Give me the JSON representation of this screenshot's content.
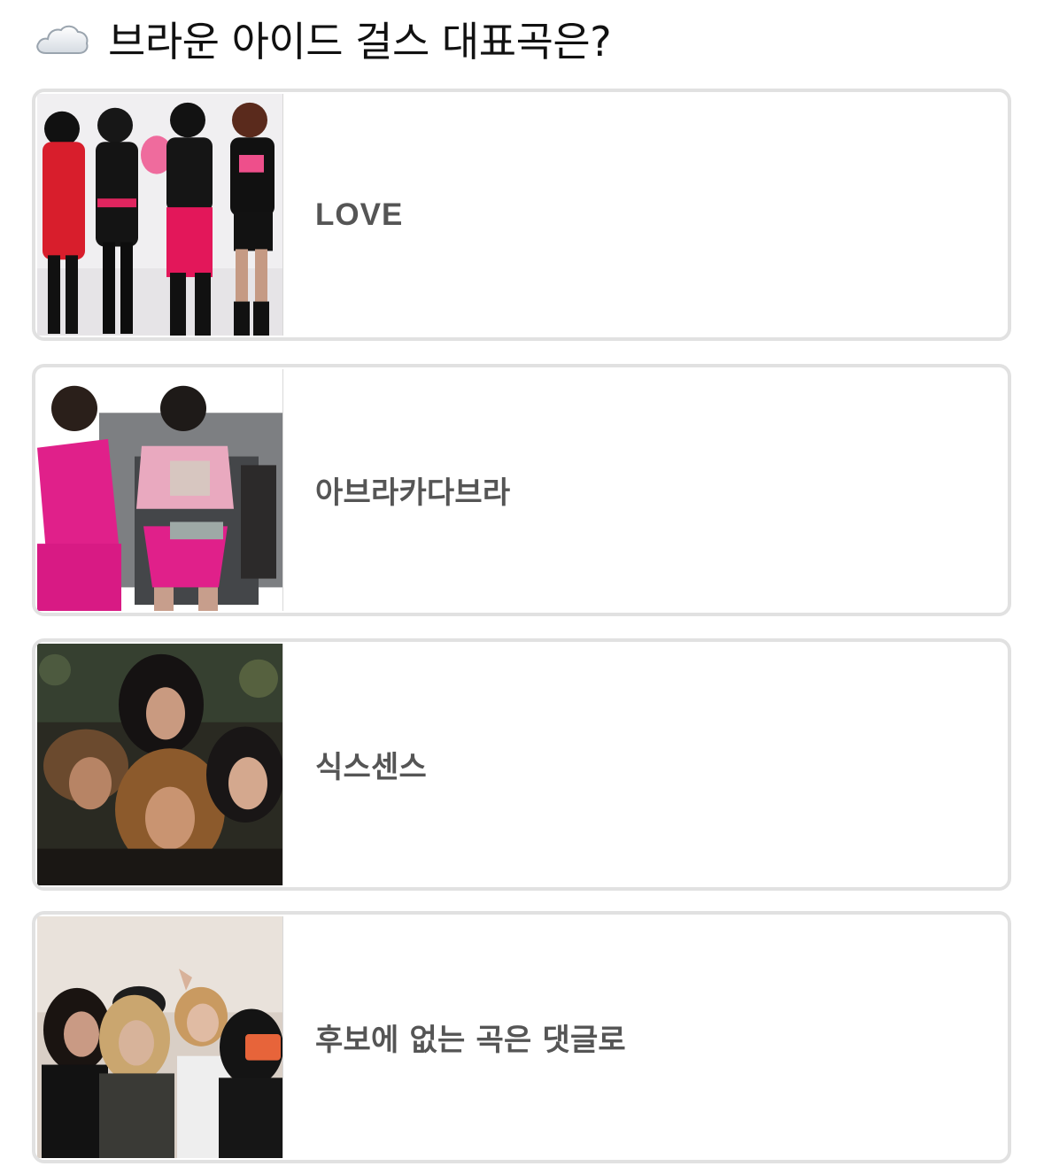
{
  "header": {
    "icon": "cloud-icon",
    "question": "브라운 아이드 걸스 대표곡은?"
  },
  "options": [
    {
      "label": "LOVE",
      "thumbnail": "photo-icon",
      "accent": "#d81e4a"
    },
    {
      "label": "아브라카다브라",
      "thumbnail": "photo-icon",
      "accent": "#e0208a"
    },
    {
      "label": "식스센스",
      "thumbnail": "photo-icon",
      "accent": "#3a3528"
    },
    {
      "label": "후보에 없는 곡은 댓글로",
      "thumbnail": "photo-icon",
      "accent": "#e7643a"
    }
  ]
}
